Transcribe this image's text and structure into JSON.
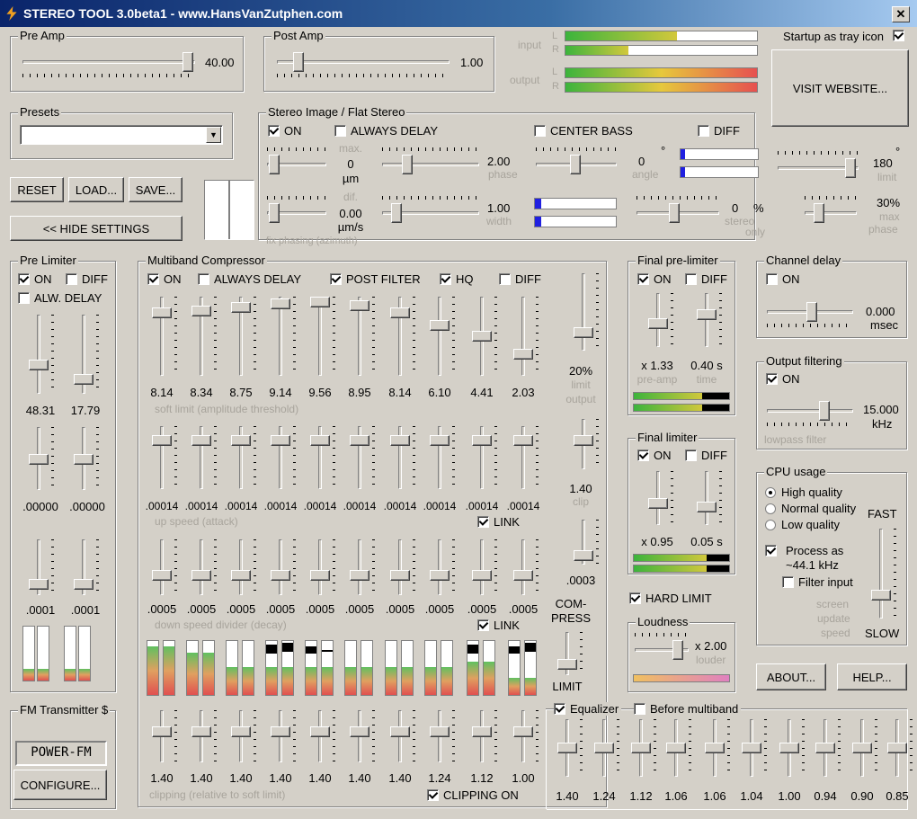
{
  "window": {
    "title": "STEREO TOOL 3.0beta1 - www.HansVanZutphen.com",
    "close": "✕"
  },
  "preamp": {
    "title": "Pre Amp",
    "value": "40.00"
  },
  "postamp": {
    "title": "Post Amp",
    "value": "1.00"
  },
  "levels": {
    "input": "input",
    "output": "output",
    "l": "L",
    "r": "R",
    "input_l": 0.58,
    "input_r": 0.33,
    "output_l": 1.0,
    "output_r": 1.0
  },
  "startup": {
    "label": "Startup as tray icon",
    "checked": true
  },
  "visit_label": "VISIT WEBSITE...",
  "presets": {
    "title": "Presets",
    "value": ""
  },
  "buttons": {
    "reset": "RESET",
    "load": "LOAD...",
    "save": "SAVE...",
    "hide": "<< HIDE SETTINGS",
    "about": "ABOUT...",
    "help": "HELP...",
    "configure": "CONFIGURE..."
  },
  "stereo": {
    "title": "Stereo Image / Flat Stereo",
    "on": "ON",
    "always_delay": "ALWAYS DELAY",
    "center_bass": "CENTER BASS",
    "diff": "DIFF",
    "max_lbl": "max.",
    "max_val": "0",
    "max_unit": "µm",
    "dif_lbl": "dif.",
    "dif_val": "0.00",
    "dif_unit": "µm/s",
    "fix_phasing": "fix phasing (azimuth)",
    "phase_val": "2.00",
    "phase_lbl": "phase",
    "width_val": "1.00",
    "width_lbl": "width",
    "angle_val": "0",
    "angle_deg": "°",
    "angle_lbl": "angle",
    "stereo_val": "0",
    "stereo_pct": "%",
    "stereo_lbl": "stereo",
    "only_lbl": "only",
    "limit_val": "180",
    "limit_deg": "°",
    "limit_lbl": "limit",
    "maxphase_val": "30%",
    "maxphase_lbl1": "max",
    "maxphase_lbl2": "phase",
    "angle_meter1": 0.06,
    "angle_meter2": 0.06,
    "width_meter1": 0.08,
    "width_meter2": 0.08
  },
  "prelimiter": {
    "title": "Pre Limiter",
    "on": "ON",
    "diff": "DIFF",
    "alw_delay": "ALW. DELAY",
    "v1": "48.31",
    "v2": "17.79",
    "v3": ".00000",
    "v4": ".00000",
    "v5": ".0001",
    "v6": ".0001"
  },
  "mbc": {
    "title": "Multiband Compressor",
    "on": "ON",
    "always_delay": "ALWAYS DELAY",
    "post_filter": "POST FILTER",
    "hq": "HQ",
    "diff": "DIFF",
    "soft": [
      "8.14",
      "8.34",
      "8.75",
      "9.14",
      "9.56",
      "8.95",
      "8.14",
      "6.10",
      "4.41",
      "2.03"
    ],
    "soft_lbl": "soft limit (amplitude threshold)",
    "up": [
      ".00014",
      ".00014",
      ".00014",
      ".00014",
      ".00014",
      ".00014",
      ".00014",
      ".00014",
      ".00014",
      ".00014"
    ],
    "up_lbl": "up speed (attack)",
    "link": "LINK",
    "down": [
      ".0005",
      ".0005",
      ".0005",
      ".0005",
      ".0005",
      ".0005",
      ".0005",
      ".0005",
      ".0005",
      ".0005"
    ],
    "down_lbl": "down speed divider (decay)",
    "clip": [
      "1.40",
      "1.40",
      "1.40",
      "1.40",
      "1.40",
      "1.40",
      "1.40",
      "1.24",
      "1.12",
      "1.00"
    ],
    "clip_lbl": "clipping (relative to soft limit)",
    "clipping_on": "CLIPPING ON",
    "limit_out_val": "20%",
    "limit_lbl": "limit",
    "output_lbl": "output",
    "clip_val": "1.40",
    "clip_lbl2": "clip",
    "last_val": ".0003",
    "compress": "COM-",
    "compress2": "PRESS",
    "limit": "LIMIT"
  },
  "final_pre": {
    "title": "Final pre-limiter",
    "on": "ON",
    "diff": "DIFF",
    "v1": "x 1.33",
    "l1": "pre-amp",
    "v2": "0.40 s",
    "l2": "time"
  },
  "final_lim": {
    "title": "Final limiter",
    "on": "ON",
    "diff": "DIFF",
    "v1": "x 0.95",
    "v2": "0.05 s"
  },
  "hard_limit": "HARD LIMIT",
  "loudness": {
    "title": "Loudness",
    "val": "x 2.00",
    "lbl": "louder"
  },
  "chdelay": {
    "title": "Channel delay",
    "on": "ON",
    "val": "0.000",
    "unit": "msec"
  },
  "outfilt": {
    "title": "Output filtering",
    "on": "ON",
    "val": "15.000",
    "unit": "kHz",
    "lbl": "lowpass filter"
  },
  "cpu": {
    "title": "CPU usage",
    "high": "High quality",
    "normal": "Normal quality",
    "low": "Low quality",
    "fast": "FAST",
    "slow": "SLOW",
    "process1": "Process as",
    "process2": "~44.1 kHz",
    "filter_input": "Filter input",
    "screen1": "screen",
    "screen2": "update",
    "screen3": "speed"
  },
  "fm": {
    "title": "FM Transmitter $",
    "lcd": "POWER-FM"
  },
  "eq": {
    "equalizer": "Equalizer",
    "before": "Before multiband",
    "values": [
      "1.40",
      "1.24",
      "1.12",
      "1.06",
      "1.06",
      "1.04",
      "1.00",
      "0.94",
      "0.90",
      "0.85"
    ]
  }
}
